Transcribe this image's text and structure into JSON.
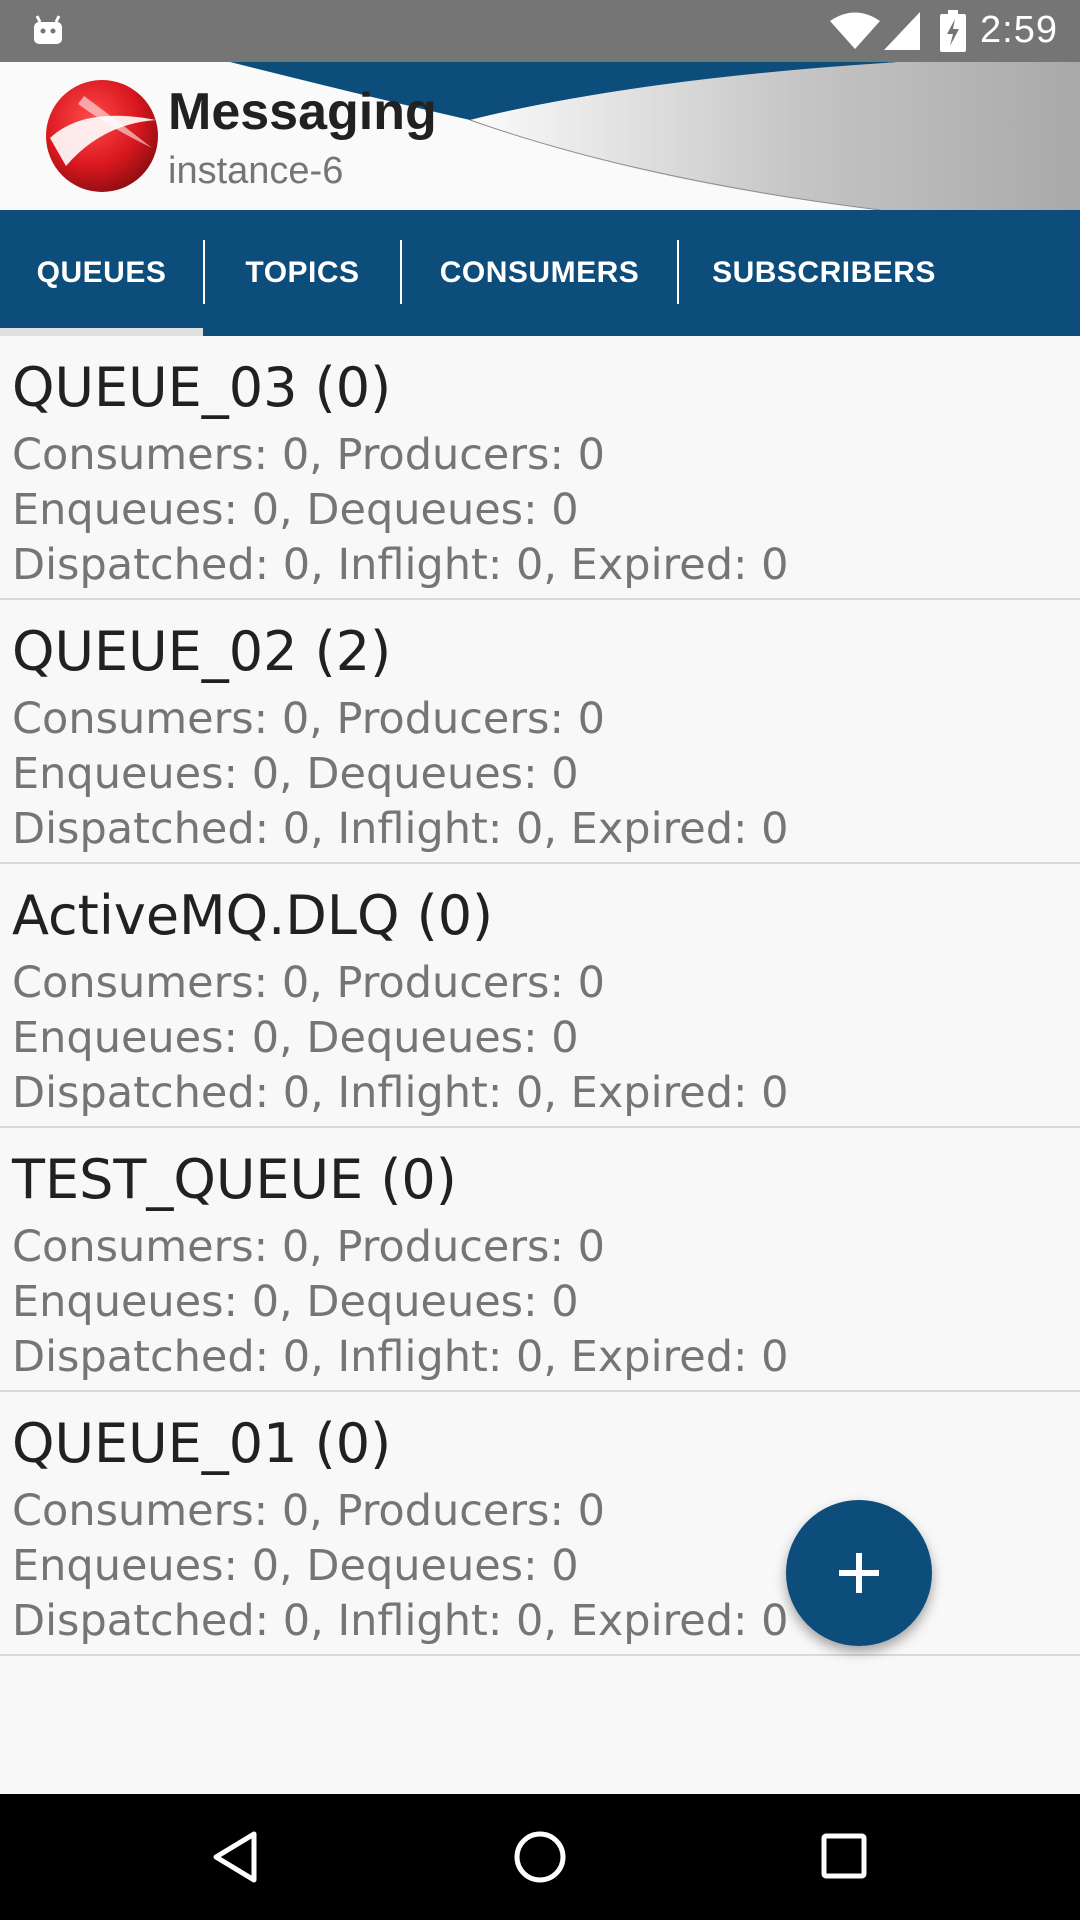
{
  "status_bar": {
    "time": "2:59",
    "icons": [
      "android-icon",
      "wifi-icon",
      "signal-icon",
      "battery-charging-icon"
    ]
  },
  "header": {
    "title": "Messaging",
    "subtitle": "instance-6"
  },
  "tabs": [
    {
      "label": "QUEUES",
      "selected": true
    },
    {
      "label": "TOPICS",
      "selected": false
    },
    {
      "label": "CONSUMERS",
      "selected": false
    },
    {
      "label": "SUBSCRIBERS",
      "selected": false
    }
  ],
  "queues": [
    {
      "name": "QUEUE_03 (0)",
      "line1": "Consumers: 0, Producers: 0",
      "line2": "Enqueues: 0, Dequeues: 0",
      "line3": "Dispatched: 0, Inflight: 0, Expired: 0"
    },
    {
      "name": "QUEUE_02 (2)",
      "line1": "Consumers: 0, Producers: 0",
      "line2": "Enqueues: 0, Dequeues: 0",
      "line3": "Dispatched: 0, Inflight: 0, Expired: 0"
    },
    {
      "name": "ActiveMQ.DLQ (0)",
      "line1": "Consumers: 0, Producers: 0",
      "line2": "Enqueues: 0, Dequeues: 0",
      "line3": "Dispatched: 0, Inflight: 0, Expired: 0"
    },
    {
      "name": "TEST_QUEUE (0)",
      "line1": "Consumers: 0, Producers: 0",
      "line2": "Enqueues: 0, Dequeues: 0",
      "line3": "Dispatched: 0, Inflight: 0, Expired: 0"
    },
    {
      "name": "QUEUE_01 (0)",
      "line1": "Consumers: 0, Producers: 0",
      "line2": "Enqueues: 0, Dequeues: 0",
      "line3": "Dispatched: 0, Inflight: 0, Expired: 0"
    }
  ],
  "fab": {
    "icon": "plus-icon"
  },
  "nav_bar": {
    "icons": [
      "back-icon",
      "home-icon",
      "recents-icon"
    ]
  },
  "colors": {
    "primary": "#0d4d7c",
    "status_bar": "#757575",
    "background": "#f8f8f8",
    "logo_red": "#d9181f"
  }
}
